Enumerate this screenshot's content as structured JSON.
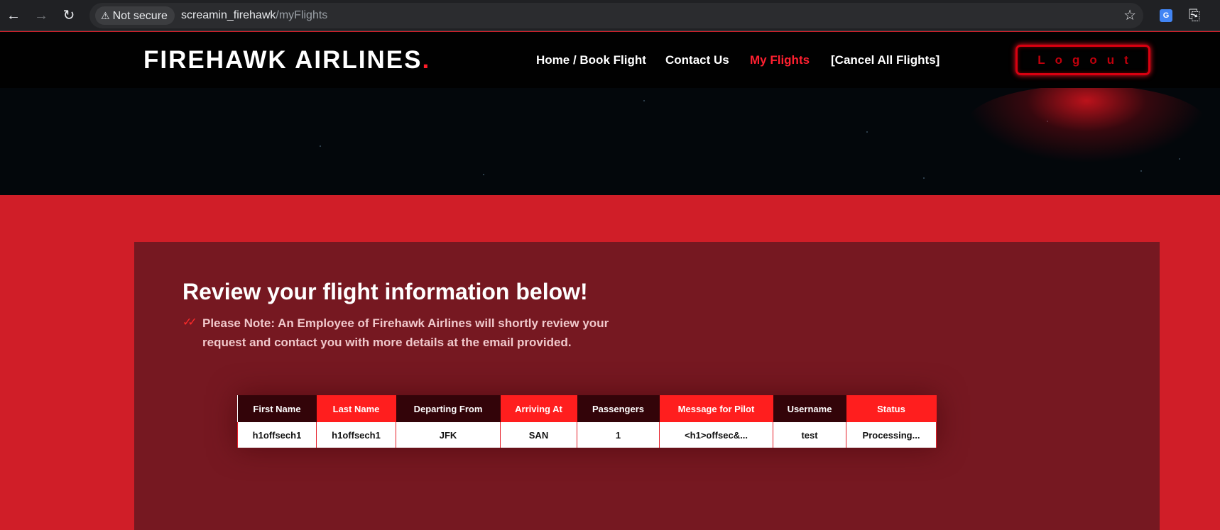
{
  "browser": {
    "security_label": "Not secure",
    "url_host": "screamin_firehawk",
    "url_path": "/myFlights",
    "icons": [
      "back-icon",
      "forward-icon",
      "reload-icon",
      "warning-icon",
      "star-icon",
      "translate-icon",
      "puzzle-icon"
    ]
  },
  "site": {
    "logo_text": "FIREHAWK AIRLINES",
    "logo_dot": ".",
    "nav": {
      "home": "Home / Book Flight",
      "contact": "Contact Us",
      "my_flights": "My Flights",
      "cancel": "[Cancel All Flights]"
    },
    "logout": "Logout",
    "accent_color": "#ff1e2a",
    "background_color": "#d01e28"
  },
  "main": {
    "title": "Review your flight information below!",
    "note": "Please Note: An Employee of Firehawk Airlines will shortly review your request and contact you with more details at the email provided.",
    "table": {
      "headers": [
        "First Name",
        "Last Name",
        "Departing From",
        "Arriving At",
        "Passengers",
        "Message for Pilot",
        "Username",
        "Status"
      ],
      "rows": [
        [
          "h1offsech1",
          "h1offsech1",
          "JFK",
          "SAN",
          "1",
          "<h1>offsec&...",
          "test",
          "Processing..."
        ]
      ]
    }
  }
}
